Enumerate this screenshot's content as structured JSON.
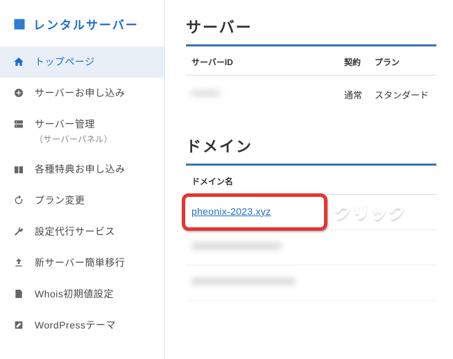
{
  "brand": {
    "title": "レンタルサーバー"
  },
  "nav": {
    "items": [
      {
        "label": "トップページ",
        "sub": ""
      },
      {
        "label": "サーバーお申し込み",
        "sub": ""
      },
      {
        "label": "サーバー管理",
        "sub": "（サーバーパネル）"
      },
      {
        "label": "各種特典お申し込み",
        "sub": ""
      },
      {
        "label": "プラン変更",
        "sub": ""
      },
      {
        "label": "設定代行サービス",
        "sub": ""
      },
      {
        "label": "新サーバー簡単移行",
        "sub": ""
      },
      {
        "label": "Whois初期値設定",
        "sub": ""
      },
      {
        "label": "WordPressテーマ",
        "sub": ""
      }
    ]
  },
  "server": {
    "title": "サーバー",
    "cols": {
      "id": "サーバーID",
      "contract": "契約",
      "plan": "プラン"
    },
    "row": {
      "id": "********",
      "contract": "通常",
      "plan": "スタンダード"
    }
  },
  "domain": {
    "title": "ドメイン",
    "col": "ドメイン名",
    "rows": [
      {
        "name": "pheonix-2023.xyz",
        "highlight": true
      },
      {
        "name": "",
        "highlight": false
      },
      {
        "name": "",
        "highlight": false
      }
    ]
  },
  "annotation": {
    "click": "クリック"
  }
}
